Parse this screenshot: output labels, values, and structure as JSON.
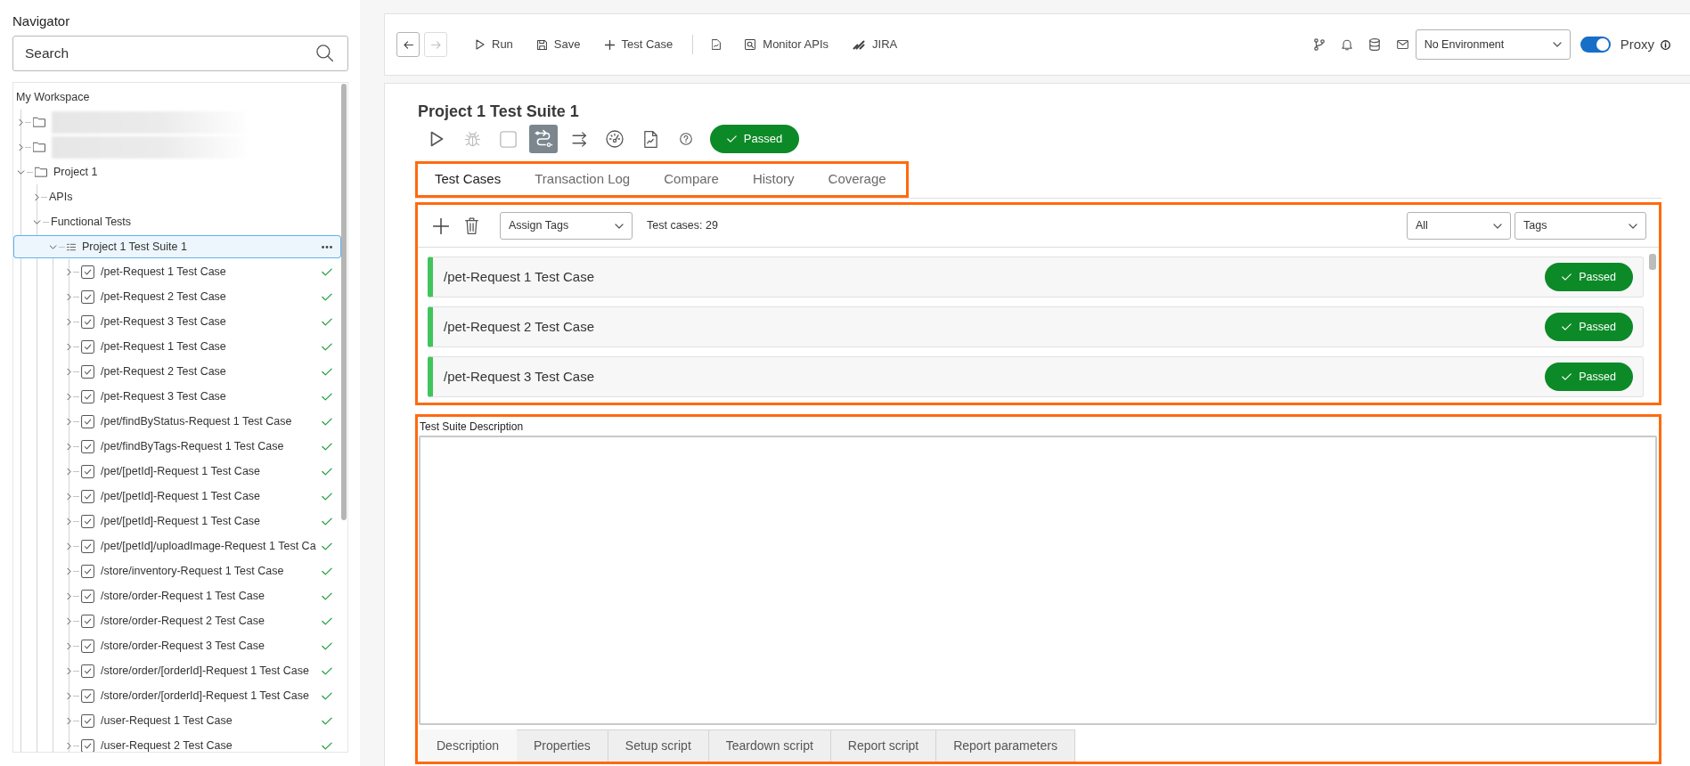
{
  "navigator": {
    "title": "Navigator",
    "search": {
      "placeholder": "Search"
    },
    "tree": [
      {
        "kind": "root",
        "label": "My Workspace",
        "selected": false,
        "children": [
          {
            "kind": "folder",
            "blurred": true,
            "expanded": false,
            "selected": false
          },
          {
            "kind": "folder",
            "blurred": true,
            "expanded": false,
            "selected": false
          },
          {
            "kind": "folder",
            "label": "Project 1",
            "expanded": true,
            "selected": false,
            "children": [
              {
                "kind": "group",
                "label": "APIs",
                "expanded": false,
                "selected": false
              },
              {
                "kind": "group",
                "label": "Functional Tests",
                "expanded": true,
                "selected": false,
                "children": [
                  {
                    "kind": "suite",
                    "label": "Project 1 Test Suite 1",
                    "expanded": true,
                    "selected": true,
                    "children": [
                      {
                        "kind": "testcase",
                        "label": "/pet-Request 1 Test Case",
                        "expanded": false,
                        "selected": false,
                        "passed": true
                      },
                      {
                        "kind": "testcase",
                        "label": "/pet-Request 2 Test Case",
                        "expanded": false,
                        "selected": false,
                        "passed": true
                      },
                      {
                        "kind": "testcase",
                        "label": "/pet-Request 3 Test Case",
                        "expanded": false,
                        "selected": false,
                        "passed": true
                      },
                      {
                        "kind": "testcase",
                        "label": "/pet-Request 1 Test Case",
                        "expanded": false,
                        "selected": false,
                        "passed": true
                      },
                      {
                        "kind": "testcase",
                        "label": "/pet-Request 2 Test Case",
                        "expanded": false,
                        "selected": false,
                        "passed": true
                      },
                      {
                        "kind": "testcase",
                        "label": "/pet-Request 3 Test Case",
                        "expanded": false,
                        "selected": false,
                        "passed": true
                      },
                      {
                        "kind": "testcase",
                        "label": "/pet/findByStatus-Request 1 Test Case",
                        "expanded": false,
                        "selected": false,
                        "passed": true
                      },
                      {
                        "kind": "testcase",
                        "label": "/pet/findByTags-Request 1 Test Case",
                        "expanded": false,
                        "selected": false,
                        "passed": true
                      },
                      {
                        "kind": "testcase",
                        "label": "/pet/[petId]-Request 1 Test Case",
                        "expanded": false,
                        "selected": false,
                        "passed": true
                      },
                      {
                        "kind": "testcase",
                        "label": "/pet/[petId]-Request 1 Test Case",
                        "expanded": false,
                        "selected": false,
                        "passed": true
                      },
                      {
                        "kind": "testcase",
                        "label": "/pet/[petId]-Request 1 Test Case",
                        "expanded": false,
                        "selected": false,
                        "passed": true
                      },
                      {
                        "kind": "testcase",
                        "label": "/pet/[petId]/uploadImage-Request 1 Test Ca",
                        "expanded": false,
                        "selected": false,
                        "passed": true
                      },
                      {
                        "kind": "testcase",
                        "label": "/store/inventory-Request 1 Test Case",
                        "expanded": false,
                        "selected": false,
                        "passed": true
                      },
                      {
                        "kind": "testcase",
                        "label": "/store/order-Request 1 Test Case",
                        "expanded": false,
                        "selected": false,
                        "passed": true
                      },
                      {
                        "kind": "testcase",
                        "label": "/store/order-Request 2 Test Case",
                        "expanded": false,
                        "selected": false,
                        "passed": true
                      },
                      {
                        "kind": "testcase",
                        "label": "/store/order-Request 3 Test Case",
                        "expanded": false,
                        "selected": false,
                        "passed": true
                      },
                      {
                        "kind": "testcase",
                        "label": "/store/order/[orderId]-Request 1 Test Case",
                        "expanded": false,
                        "selected": false,
                        "passed": true
                      },
                      {
                        "kind": "testcase",
                        "label": "/store/order/[orderId]-Request 1 Test Case",
                        "expanded": false,
                        "selected": false,
                        "passed": true
                      },
                      {
                        "kind": "testcase",
                        "label": "/user-Request 1 Test Case",
                        "expanded": false,
                        "selected": false,
                        "passed": true
                      },
                      {
                        "kind": "testcase",
                        "label": "/user-Request 2 Test Case",
                        "expanded": false,
                        "selected": false,
                        "passed": true
                      }
                    ]
                  }
                ]
              }
            ]
          }
        ]
      }
    ]
  },
  "toolbar": {
    "history": [
      {
        "kind": "back",
        "disabled": false
      },
      {
        "kind": "forward",
        "disabled": true
      }
    ],
    "action_groups": [
      [
        {
          "kind": "run",
          "label": "Run"
        },
        {
          "kind": "save",
          "label": "Save"
        },
        {
          "kind": "add",
          "label": "Test Case"
        }
      ],
      [
        {
          "kind": "report"
        },
        {
          "kind": "monitor",
          "label": "Monitor APIs"
        },
        {
          "kind": "jira",
          "label": "JIRA"
        }
      ]
    ],
    "status_icons": [
      {
        "kind": "branch"
      },
      {
        "kind": "bell"
      },
      {
        "kind": "database"
      },
      {
        "kind": "mail"
      }
    ],
    "environment": {
      "value": "No Environment"
    },
    "proxy": {
      "label": "Proxy",
      "on": true
    }
  },
  "suite": {
    "title": "Project 1 Test Suite 1",
    "tools": [
      {
        "kind": "run",
        "disabled": false,
        "selected": false
      },
      {
        "kind": "debug",
        "disabled": true,
        "selected": false
      },
      {
        "kind": "stop",
        "disabled": true,
        "selected": false
      },
      {
        "kind": "flow",
        "disabled": false,
        "selected": true
      },
      {
        "kind": "parallel",
        "disabled": false,
        "selected": false
      },
      {
        "kind": "load",
        "disabled": false,
        "selected": false
      },
      {
        "kind": "report",
        "disabled": false,
        "selected": false
      },
      {
        "kind": "help",
        "disabled": false,
        "selected": false
      }
    ],
    "status": {
      "kind": "passed",
      "label": "Passed"
    },
    "tabs": {
      "highlighted": true,
      "items": [
        {
          "label": "Test Cases",
          "selected": true
        },
        {
          "label": "Transaction Log",
          "selected": false
        },
        {
          "label": "Compare",
          "selected": false
        },
        {
          "label": "History",
          "selected": false
        },
        {
          "label": "Coverage",
          "selected": false
        }
      ]
    },
    "test_cases": {
      "highlighted": true,
      "assign_tags": {
        "value": "Assign Tags"
      },
      "count": "Test cases: 29",
      "filters": [
        {
          "value": "All"
        },
        {
          "value": "Tags"
        }
      ],
      "rows": [
        {
          "label": "/pet-Request 1 Test Case",
          "status": {
            "kind": "passed",
            "label": "Passed"
          }
        },
        {
          "label": "/pet-Request 2 Test Case",
          "status": {
            "kind": "passed",
            "label": "Passed"
          }
        },
        {
          "label": "/pet-Request 3 Test Case",
          "status": {
            "kind": "passed",
            "label": "Passed"
          }
        }
      ]
    },
    "description": {
      "highlighted": true,
      "label": "Test Suite Description",
      "tabs": [
        {
          "label": "Description",
          "selected": true
        },
        {
          "label": "Properties",
          "selected": false
        },
        {
          "label": "Setup script",
          "selected": false
        },
        {
          "label": "Teardown script",
          "selected": false
        },
        {
          "label": "Report script",
          "selected": false
        },
        {
          "label": "Report parameters",
          "selected": false
        }
      ]
    }
  }
}
